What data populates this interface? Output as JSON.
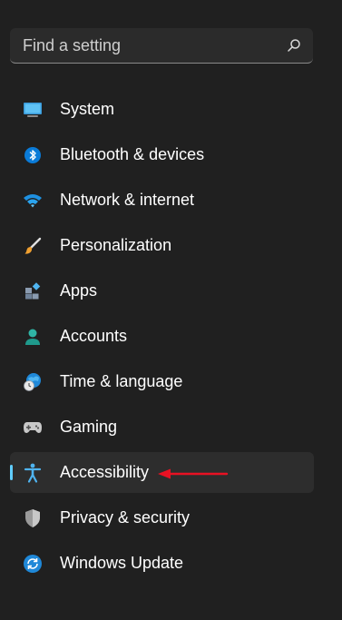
{
  "search": {
    "placeholder": "Find a setting",
    "icon": "search-icon"
  },
  "nav": {
    "items": [
      {
        "label": "System",
        "icon": "system-monitor-icon"
      },
      {
        "label": "Bluetooth & devices",
        "icon": "bluetooth-icon"
      },
      {
        "label": "Network & internet",
        "icon": "wifi-icon"
      },
      {
        "label": "Personalization",
        "icon": "paintbrush-icon"
      },
      {
        "label": "Apps",
        "icon": "apps-icon"
      },
      {
        "label": "Accounts",
        "icon": "person-icon"
      },
      {
        "label": "Time & language",
        "icon": "globe-clock-icon"
      },
      {
        "label": "Gaming",
        "icon": "gamepad-icon"
      },
      {
        "label": "Accessibility",
        "icon": "accessibility-icon",
        "selected": true
      },
      {
        "label": "Privacy & security",
        "icon": "shield-icon"
      },
      {
        "label": "Windows Update",
        "icon": "update-icon"
      }
    ]
  },
  "colors": {
    "background": "#202020",
    "selected_item": "#2d2d2d",
    "accent": "#60cdff",
    "annotation_arrow": "#e81123"
  }
}
